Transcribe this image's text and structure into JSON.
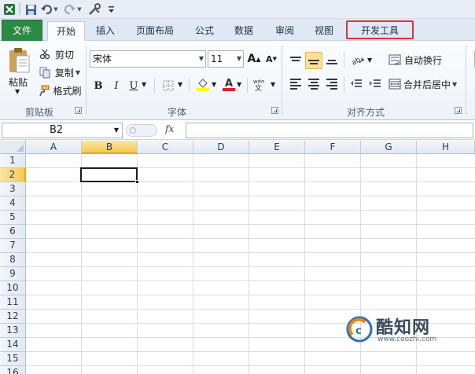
{
  "quick_access": {
    "icons": [
      "excel-logo-icon",
      "save-icon",
      "undo-icon",
      "redo-icon",
      "customize-icon"
    ]
  },
  "tabs": [
    {
      "label": "文件",
      "state": "file"
    },
    {
      "label": "开始",
      "state": "active"
    },
    {
      "label": "插入"
    },
    {
      "label": "页面布局"
    },
    {
      "label": "公式"
    },
    {
      "label": "数据"
    },
    {
      "label": "审阅"
    },
    {
      "label": "视图"
    },
    {
      "label": "开发工具",
      "state": "highlighted"
    }
  ],
  "highlight_color": "#d8333a",
  "clipboard": {
    "paste_label": "粘贴",
    "cut_label": "剪切",
    "copy_label": "复制",
    "format_painter_label": "格式刷",
    "group_label": "剪贴板"
  },
  "font": {
    "font_name": "宋体",
    "font_size": "11",
    "bold": "B",
    "italic": "I",
    "underline": "U",
    "group_label": "字体",
    "font_color": "#e02020",
    "fill_color": "#ffff00"
  },
  "alignment": {
    "wrap_text_label": "自动换行",
    "merge_center_label": "合并后居中",
    "group_label": "对齐方式"
  },
  "formula_bar": {
    "name_box": "B2",
    "fx_label": "fx"
  },
  "sheet": {
    "columns": [
      "A",
      "B",
      "C",
      "D",
      "E",
      "F",
      "G",
      "H"
    ],
    "rows": [
      "1",
      "2",
      "3",
      "4",
      "5",
      "6",
      "7",
      "8",
      "9",
      "10",
      "11",
      "12",
      "13",
      "14",
      "15",
      "16"
    ],
    "selected_column": "B",
    "selected_row": "2"
  },
  "watermark": {
    "name": "酷知网",
    "url": "www.coozhi.com"
  }
}
